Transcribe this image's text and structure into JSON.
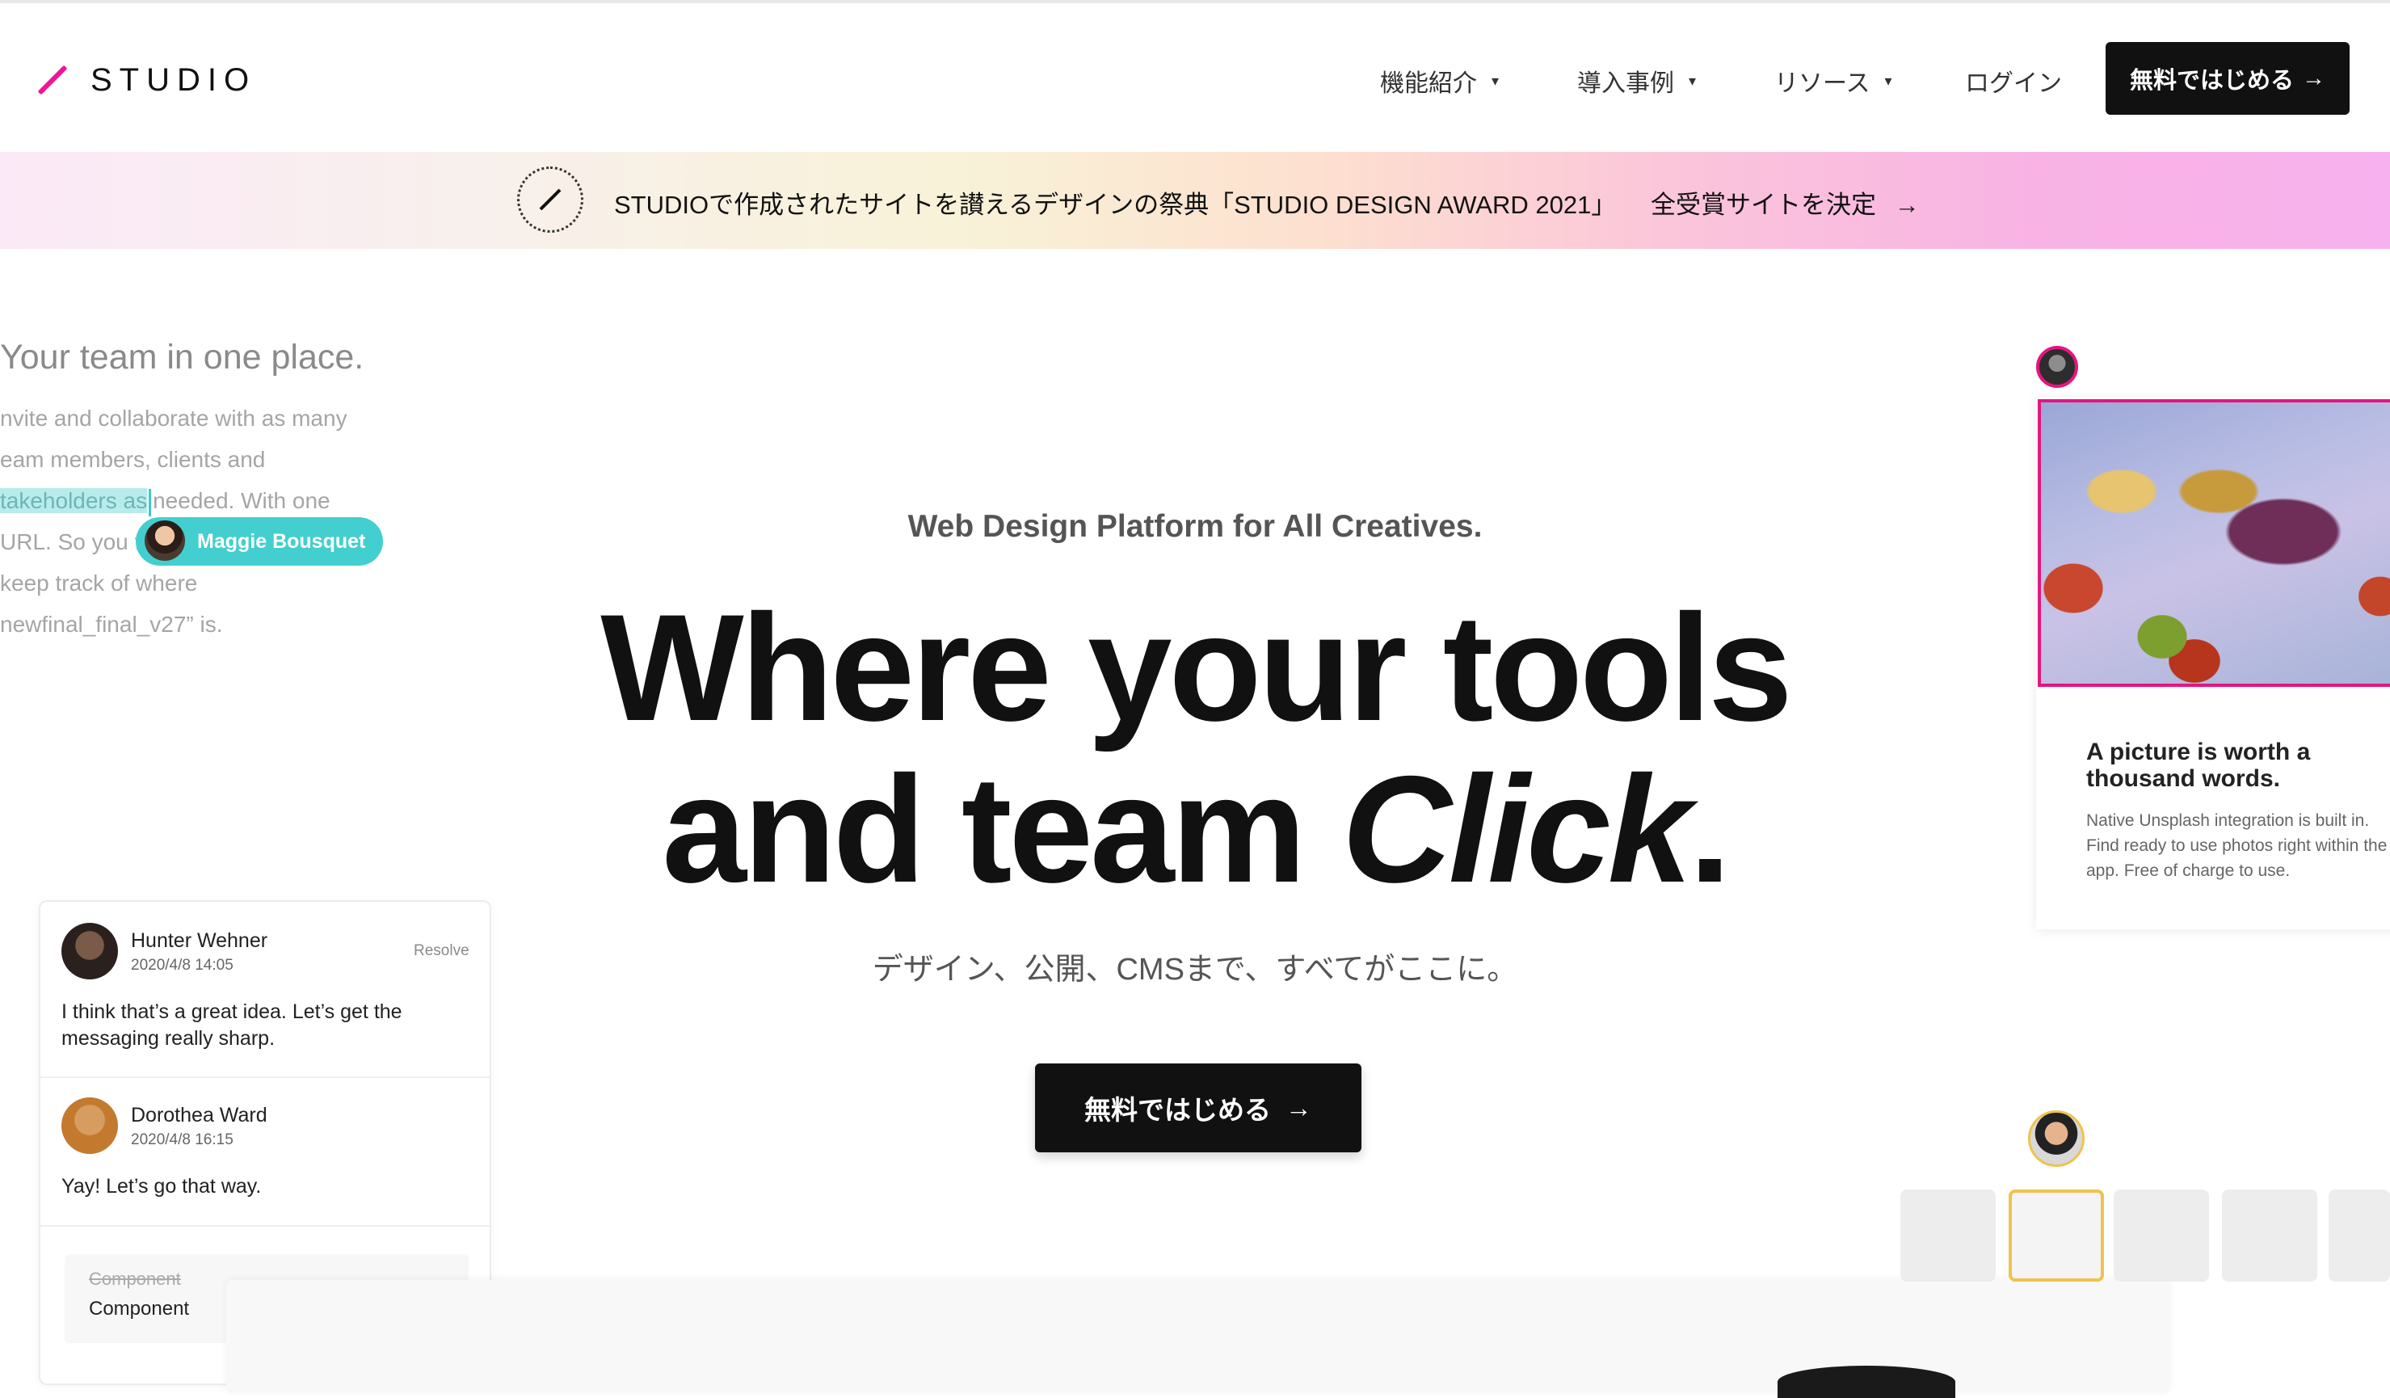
{
  "header": {
    "logo_text": "STUDIO",
    "nav": [
      {
        "label": "機能紹介",
        "has_dropdown": true
      },
      {
        "label": "導入事例",
        "has_dropdown": true
      },
      {
        "label": "リソース",
        "has_dropdown": true
      },
      {
        "label": "ログイン",
        "has_dropdown": false
      }
    ],
    "cta_label": "無料ではじめる",
    "cta_arrow": "→"
  },
  "banner": {
    "text": "STUDIOで作成されたサイトを讃えるデザインの祭典「STUDIO DESIGN AWARD 2021」",
    "link_text": "全受賞サイトを決定",
    "arrow": "→"
  },
  "team_panel": {
    "title": "Your team in one place.",
    "lines": [
      "nvite and collaborate with as many",
      "eam members, clients and",
      "takeholders as",
      "needed. With one",
      "URL. So you fi",
      "keep track of where",
      "newfinal_final_v27” is."
    ],
    "presence_name": "Maggie Bousquet"
  },
  "comments": [
    {
      "name": "Hunter Wehner",
      "time": "2020/4/8 14:05",
      "message": "I think that’s a great idea. Let’s get the messaging really sharp.",
      "action": "Resolve"
    },
    {
      "name": "Dorothea Ward",
      "time": "2020/4/8 16:15",
      "message": "Yay! Let’s go that way."
    }
  ],
  "component_edit": {
    "old": "Component",
    "new": "Component"
  },
  "hero": {
    "subtitle": "Web Design Platform for All Creatives.",
    "title_line1": "Where your tools",
    "title_line2_start": "and team ",
    "title_line2_italic": "Click",
    "title_line2_end": ".",
    "tagline": "デザイン、公開、CMSまで、すべてがここに。",
    "cta_label": "無料ではじめる",
    "cta_arrow": "→"
  },
  "picture_card": {
    "title": "A picture is worth a thousand words.",
    "description": "Native Unsplash integration is built in. Find ready to use photos right within the app. Free of charge to use."
  },
  "colors": {
    "accent_pink": "#e5157f",
    "teal": "#43cfcf",
    "yellow_highlight": "#f0c24e",
    "button_black": "#111111"
  }
}
